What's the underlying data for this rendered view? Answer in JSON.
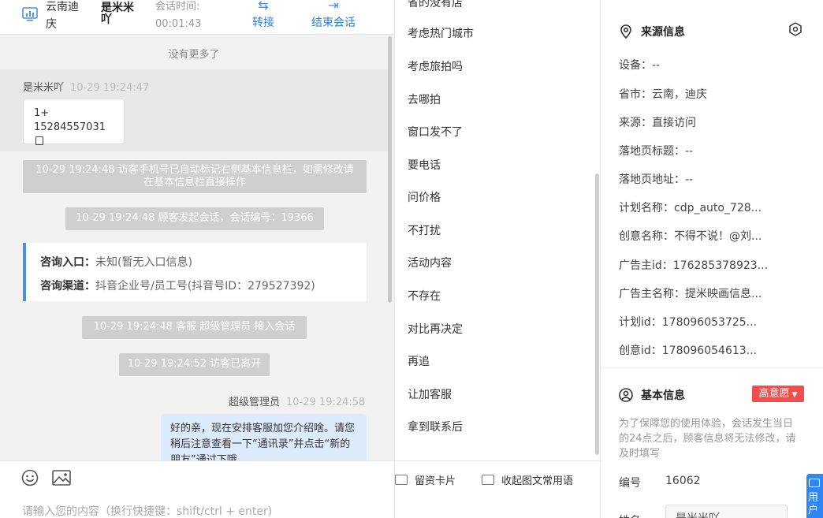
{
  "header": {
    "location": "云南迪庆",
    "visitor_name": "是米米吖",
    "timer_label": "会话时间:",
    "timer_value": "00:01:43",
    "transfer_label": "转接",
    "end_label": "结束会话"
  },
  "chat": {
    "no_more": "没有更多了",
    "visitor_msg": {
      "sender": "是米米吖",
      "time": "10-29 19:24:47",
      "line1": "1+",
      "line2": "15284557031"
    },
    "sys_msgs": [
      "10-29 19:24:48 访客手机号已自动标记右侧基本信息栏，如需修改请在基本信息栏直接操作",
      "10-29 19:24:48 顾客发起会话，会话编号：19366",
      "10-29 19:24:48 客服 超级管理员 接入会话",
      "10-29 19:24:52 访客已离开"
    ],
    "consult": {
      "entry_label": "咨询入口：",
      "entry_value": "未知(暂无入口信息)",
      "channel_label": "咨询渠道：",
      "channel_value": "抖音企业号/员工号(抖音号ID：279527392)"
    },
    "agent_msg": {
      "sender": "超级管理员",
      "time": "10-29 19:24:58",
      "text": "好的亲，现在安排客服加您介绍啥。请您稍后注意查看一下“通讯录”并点击“新的朋友”通过下哦"
    },
    "input_placeholder": "请输入您的内容（换行快捷键：shift/ctrl + enter)"
  },
  "quick_replies": {
    "items": [
      "省的没有店",
      "考虑热门城市",
      "考虑旅拍吗",
      "去哪拍",
      "窗口发不了",
      "要电话",
      "问价格",
      "不打扰",
      "活动内容",
      "不存在",
      "对比再决定",
      "再追",
      "让加客服",
      "拿到联系后"
    ],
    "card_button": "留资卡片",
    "collapse_button": "收起图文常用语"
  },
  "source_info": {
    "title": "来源信息",
    "rows": [
      "设备：--",
      "省市：云南，迪庆",
      "来源：直接访问",
      "落地页标题：--",
      "落地页地址：--",
      "计划名称：cdp_auto_728...",
      "创意名称：不得不说！@刘...",
      "广告主id：176285378923...",
      "广告主名称：提米映画信息...",
      "计划id：178096053725...",
      "创意id：178096054613..."
    ]
  },
  "basic_info": {
    "title": "基本信息",
    "intent_badge": "高意愿",
    "notice": "为了保障您的使用体验，会话发生当日的24点之后，顾客信息将无法修改，请及时填写",
    "id_label": "编号",
    "id_value": "16062",
    "name_label": "姓名",
    "name_value": "是米米吖",
    "fab_label": "用户"
  },
  "colors": {
    "accent": "#2d7fe0",
    "badge": "#f24e4e",
    "agent_bubble": "#dcebfc",
    "sys_bg": "#cfcfcf"
  }
}
